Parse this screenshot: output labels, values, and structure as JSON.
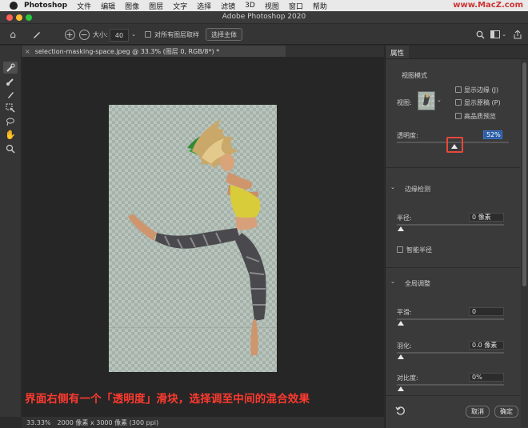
{
  "menubar": {
    "items": [
      "Photoshop",
      "文件",
      "编辑",
      "图像",
      "图层",
      "文字",
      "选择",
      "滤镜",
      "3D",
      "视图",
      "窗口",
      "帮助"
    ],
    "brand": "www.MacZ.com"
  },
  "titlebar": {
    "title": "Adobe Photoshop 2020",
    "traffic_colors": [
      "#fe5f57",
      "#febc2e",
      "#28c840"
    ]
  },
  "options": {
    "size_label": "大小:",
    "size_value": "40",
    "sample_all_layers": "对所有图层取样",
    "select_subject": "选择主体"
  },
  "document": {
    "tab_label": "selection-masking-space.jpeg @ 33.3% (图层 0, RGB/8*) *"
  },
  "status": {
    "zoom": "33.33%",
    "info": "2000 像素 x 3000 像素 (300 ppi)"
  },
  "caption": "界面右侧有一个「透明度」滑块，选择调至中间的混合效果",
  "accent_color": "#e8473a",
  "properties": {
    "tab": "属性",
    "view_mode": {
      "title": "视图模式",
      "view_label": "视图:",
      "show_edge": "显示边缘 (J)",
      "show_original": "显示原稿 (P)",
      "hq_preview": "高品质预览"
    },
    "opacity": {
      "label": "透明度:",
      "value": "52%",
      "level": 52
    },
    "edge_detection": {
      "title": "边缘检测",
      "radius_label": "半径:",
      "radius_value": "0 像素",
      "smart_radius": "智能半径"
    },
    "global": {
      "title": "全局调整",
      "smooth_label": "平滑:",
      "smooth_value": "0",
      "feather_label": "羽化:",
      "feather_value": "0.0 像素",
      "contrast_label": "对比度:",
      "contrast_value": "0%"
    },
    "cancel": "取消",
    "ok": "确定"
  }
}
